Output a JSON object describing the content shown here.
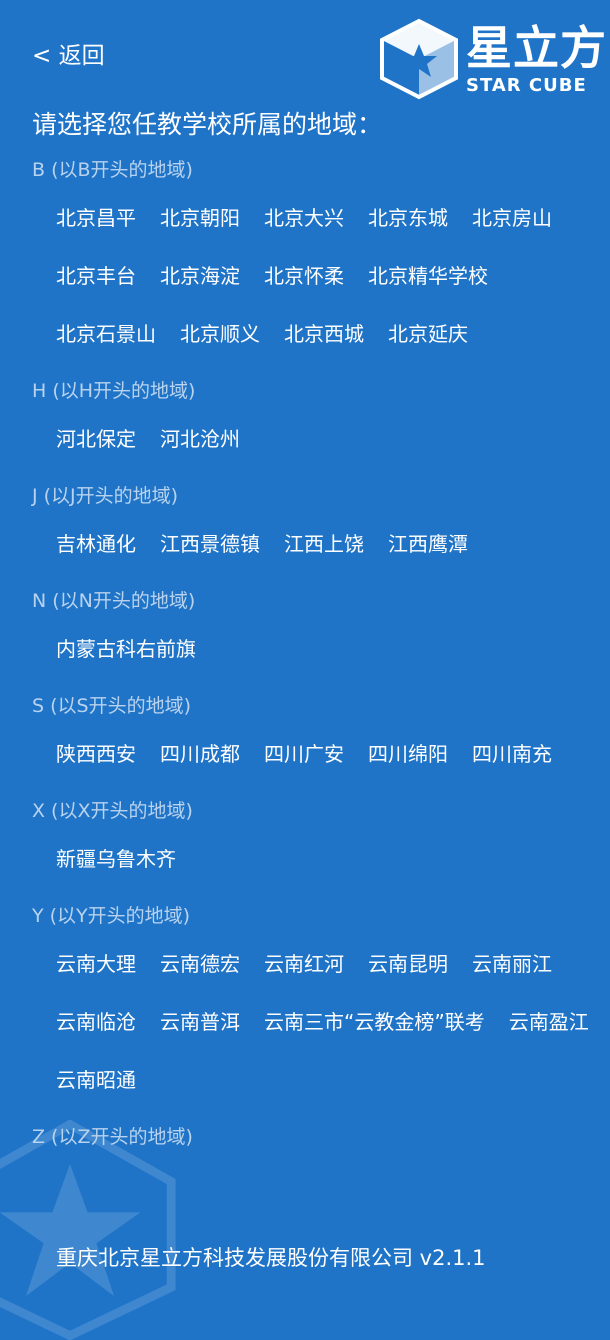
{
  "nav": {
    "back_label": "< 返回"
  },
  "logo": {
    "cn": "星立方",
    "en": "STAR CUBE"
  },
  "prompt": "请选择您任教学校所属的地域：",
  "groups": [
    {
      "header": "B (以B开头的地域)",
      "items": [
        "北京昌平",
        "北京朝阳",
        "北京大兴",
        "北京东城",
        "北京房山",
        "北京丰台",
        "北京海淀",
        "北京怀柔",
        "北京精华学校",
        "北京石景山",
        "北京顺义",
        "北京西城",
        "北京延庆"
      ]
    },
    {
      "header": "H (以H开头的地域)",
      "items": [
        "河北保定",
        "河北沧州"
      ]
    },
    {
      "header": "J (以J开头的地域)",
      "items": [
        "吉林通化",
        "江西景德镇",
        "江西上饶",
        "江西鹰潭"
      ]
    },
    {
      "header": "N (以N开头的地域)",
      "items": [
        "内蒙古科右前旗"
      ]
    },
    {
      "header": "S (以S开头的地域)",
      "items": [
        "陕西西安",
        "四川成都",
        "四川广安",
        "四川绵阳",
        "四川南充"
      ]
    },
    {
      "header": "X (以X开头的地域)",
      "items": [
        "新疆乌鲁木齐"
      ]
    },
    {
      "header": "Y (以Y开头的地域)",
      "items": [
        "云南大理",
        "云南德宏",
        "云南红河",
        "云南昆明",
        "云南丽江",
        "云南临沧",
        "云南普洱",
        "云南三市“云教金榜”联考",
        "云南盈江",
        "云南昭通"
      ]
    },
    {
      "header": "Z (以Z开头的地域)",
      "items": []
    }
  ],
  "footer": "重庆北京星立方科技发展股份有限公司 v2.1.1",
  "colors": {
    "background": "#1f74c8",
    "header_text": "#b9d3ee",
    "text": "#ffffff"
  }
}
